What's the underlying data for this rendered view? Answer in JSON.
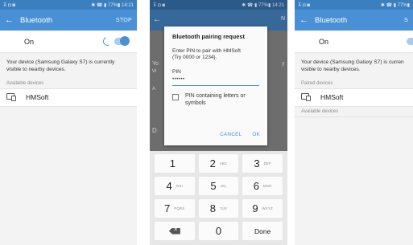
{
  "screen1": {
    "status": {
      "left": "⊼ ◘ ◙",
      "right": "✱ ☎ ▮ 77%▮ 14:21"
    },
    "title": "Bluetooth",
    "stop": "STOP",
    "on_label": "On",
    "visible_text_1": "Your device (Samsung Galaxy S7) is currently",
    "visible_text_2": "visible to nearby devices.",
    "section": "Available devices",
    "device": "HMSoft"
  },
  "screen2": {
    "status": {
      "left": "⊼ ◘ ◙",
      "right": "✱ ☎ ▮ 77%▮ 14:21"
    },
    "peek_back": "←",
    "peek_n": "N",
    "peek_y1": "Yo",
    "peek_y2": "vi",
    "peek_a": "A",
    "peek_y3": "y",
    "peek_d": "D",
    "dialog": {
      "title": "Bluetooth pairing request",
      "msg_line1": "Enter PIN to pair with HMSoft",
      "msg_line2": "(Try 0000 or 1234).",
      "pin_label": "PIN",
      "pin_value": "••••••",
      "checkbox_line1": "PIN containing letters or",
      "checkbox_line2": "symbols",
      "cancel": "CANCEL",
      "ok": "OK"
    },
    "keys": [
      {
        "num": "1",
        "sub": ""
      },
      {
        "num": "2",
        "sub": "ABC"
      },
      {
        "num": "3",
        "sub": "DEF"
      },
      {
        "num": "4",
        "sub": "GHI"
      },
      {
        "num": "5",
        "sub": "JKL"
      },
      {
        "num": "6",
        "sub": "MNO"
      },
      {
        "num": "7",
        "sub": "PQRS"
      },
      {
        "num": "8",
        "sub": "TUV"
      },
      {
        "num": "9",
        "sub": "WXYZ"
      },
      {
        "num": "0",
        "sub": ""
      }
    ],
    "done": "Done"
  },
  "screen3": {
    "status": {
      "left": "⊼ ◘ ◙",
      "right": "✱ ☎ ▮ 77%▮"
    },
    "title": "Bluetooth",
    "stop": "S",
    "on_label": "On",
    "visible_text_1": "Your device (Samsung Galaxy S7) is curren",
    "visible_text_2": "visible to nearby devices.",
    "paired_section": "Paired devices",
    "device": "HMSoft",
    "available_section": "Available devices"
  }
}
